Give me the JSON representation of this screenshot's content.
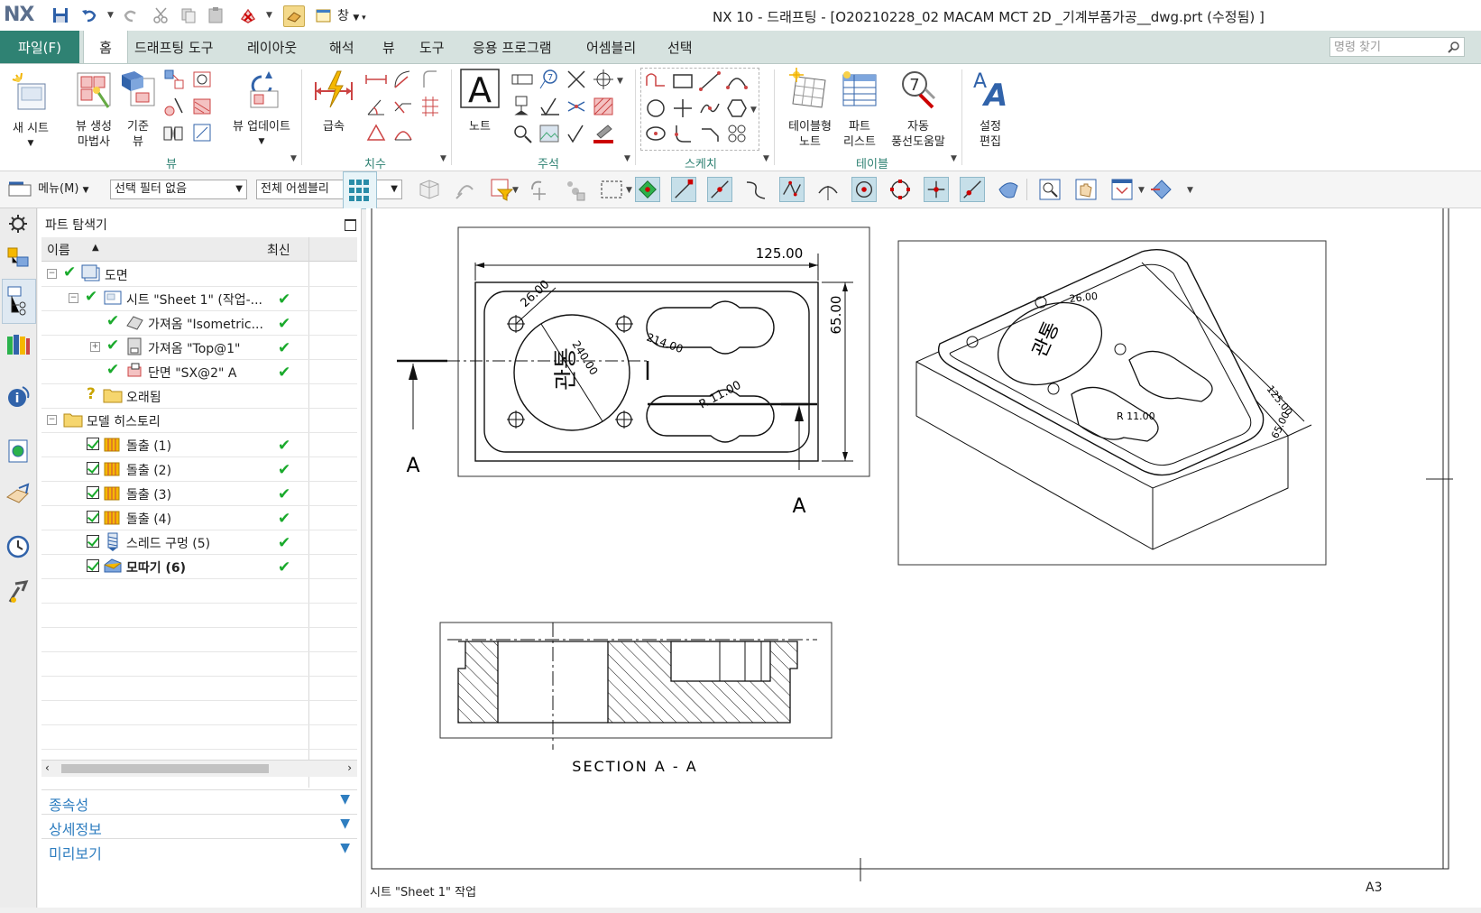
{
  "app": {
    "logo": "NX",
    "title": "NX 10 - 드래프팅 - [O20210228_02 MACAM MCT 2D _기계부품가공__dwg.prt (수정됨) ]",
    "window_menu": "창"
  },
  "menu_tabs": {
    "file": "파일(F)",
    "home": "홈",
    "drafting_tools": "드래프팅 도구",
    "layout": "레이아웃",
    "analysis": "해석",
    "view": "뷰",
    "tools": "도구",
    "application": "응용 프로그램",
    "assembly": "어셈블리",
    "select": "선택"
  },
  "command_search": {
    "placeholder": "명령 찾기"
  },
  "ribbon": {
    "new_sheet": "새 시트",
    "view_wizard_1": "뷰 생성",
    "view_wizard_2": "마법사",
    "base_view_1": "기준",
    "base_view_2": "뷰",
    "update_view": "뷰 업데이트",
    "rapid": "급속",
    "note": "노트",
    "tabular_note_1": "테이블형",
    "tabular_note_2": "노트",
    "parts_list_1": "파트",
    "parts_list_2": "리스트",
    "auto_balloon_1": "자동",
    "auto_balloon_2": "풍선도움말",
    "edit_settings_1": "설정",
    "edit_settings_2": "편집",
    "groups": {
      "view": "뷰",
      "dimension": "치수",
      "annotation": "주석",
      "sketch": "스케치",
      "table": "테이블"
    }
  },
  "toolbar": {
    "menu_label": "메뉴(M)",
    "selection_filter": "선택 필터 없음",
    "assembly_scope": "전체 어셈블리"
  },
  "navigator": {
    "title": "파트 탐색기",
    "col_name": "이름",
    "col_latest": "최신",
    "rows": [
      {
        "label": "도면"
      },
      {
        "label": "시트 \"Sheet 1\" (작업-..."
      },
      {
        "label": "가져옴 \"Isometric..."
      },
      {
        "label": "가져옴 \"Top@1\""
      },
      {
        "label": "단면 \"SX@2\" A"
      },
      {
        "label": "오래됨"
      },
      {
        "label": "모델 히스토리"
      },
      {
        "label": "돌출 (1)"
      },
      {
        "label": "돌출 (2)"
      },
      {
        "label": "돌출 (3)"
      },
      {
        "label": "돌출 (4)"
      },
      {
        "label": "스레드 구멍 (5)"
      },
      {
        "label": "모따기 (6)"
      }
    ],
    "panels": {
      "dependencies": "종속성",
      "details": "상세정보",
      "preview": "미리보기"
    }
  },
  "drawing": {
    "dim_width": "125.00",
    "dim_height": "65.00",
    "dim_hole": "26.00",
    "dim_circle": "240.00",
    "dim_slot": "214.00",
    "dim_radius": "R 11.00",
    "section_letter": "A",
    "section_title": "SECTION  A - A",
    "iso_dim_hole": "26.00",
    "iso_dim_length": "125.00",
    "iso_dim_height": "65.00",
    "iso_dim_radius": "R 11.00",
    "engraving": "관통",
    "sheet_status": "시트 \"Sheet 1\" 작업",
    "sheet_size": "A3"
  }
}
